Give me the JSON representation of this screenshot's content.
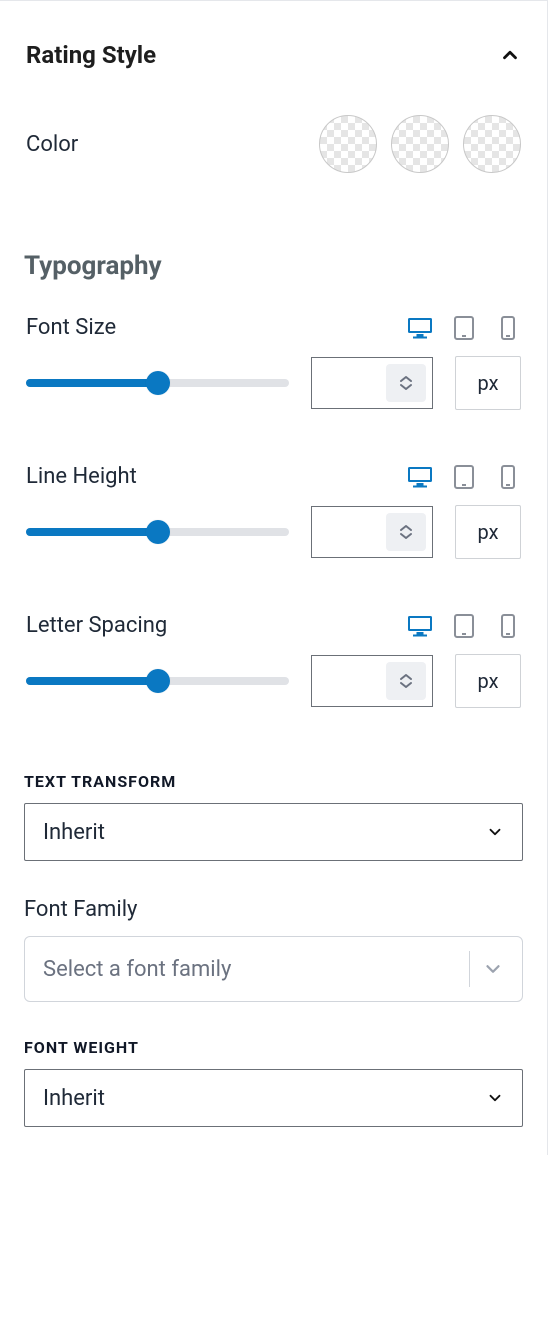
{
  "section": {
    "title": "Rating Style",
    "expanded": true
  },
  "color": {
    "label": "Color",
    "swatches": 3
  },
  "typography": {
    "title": "Typography",
    "controls": [
      {
        "label": "Font Size",
        "active_device": "desktop",
        "unit": "px",
        "slider_pct": 50,
        "value": ""
      },
      {
        "label": "Line Height",
        "active_device": "desktop",
        "unit": "px",
        "slider_pct": 50,
        "value": ""
      },
      {
        "label": "Letter Spacing",
        "active_device": "desktop",
        "unit": "px",
        "slider_pct": 50,
        "value": ""
      }
    ]
  },
  "text_transform": {
    "label": "TEXT TRANSFORM",
    "value": "Inherit"
  },
  "font_family": {
    "label": "Font Family",
    "placeholder": "Select a font family"
  },
  "font_weight": {
    "label": "FONT WEIGHT",
    "value": "Inherit"
  }
}
